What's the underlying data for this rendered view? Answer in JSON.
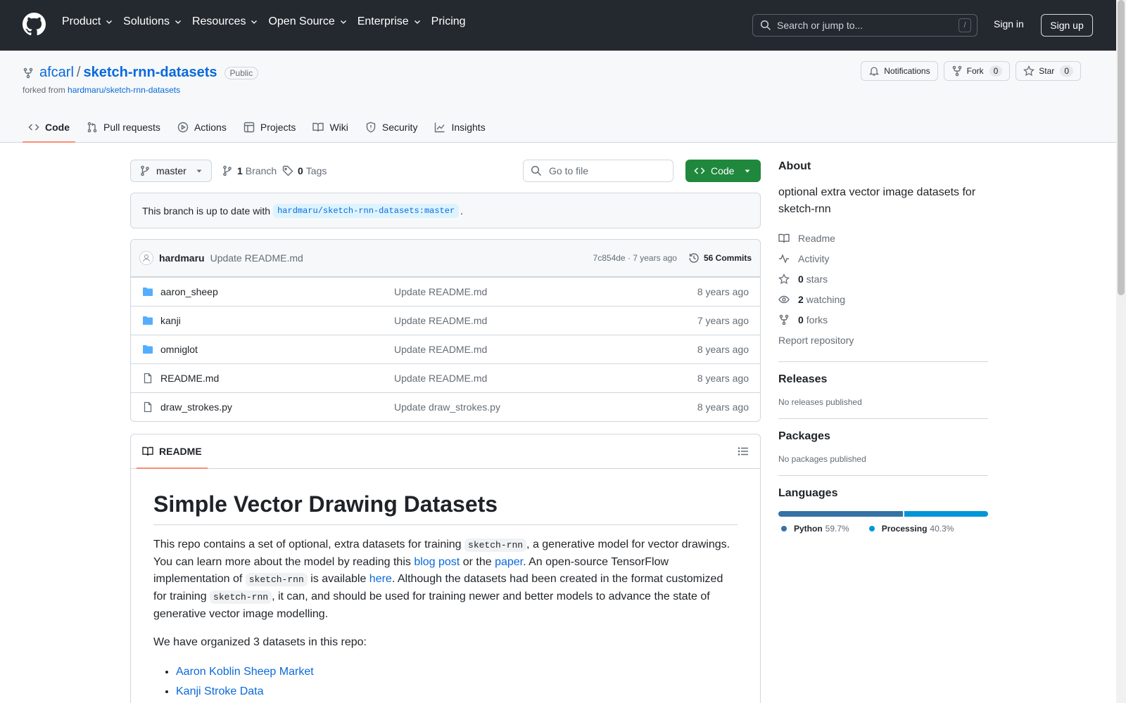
{
  "header": {
    "nav": [
      "Product",
      "Solutions",
      "Resources",
      "Open Source",
      "Enterprise"
    ],
    "pricing": "Pricing",
    "search_placeholder": "Search or jump to...",
    "search_key": "/",
    "sign_in": "Sign in",
    "sign_up": "Sign up"
  },
  "repo": {
    "owner": "afcarl",
    "separator": "/",
    "name": "sketch-rnn-datasets",
    "visibility": "Public",
    "forked_from_prefix": "forked from ",
    "forked_from": "hardmaru/sketch-rnn-datasets",
    "notifications_label": "Notifications",
    "fork_label": "Fork",
    "fork_count": "0",
    "star_label": "Star",
    "star_count": "0"
  },
  "tabs": [
    "Code",
    "Pull requests",
    "Actions",
    "Projects",
    "Wiki",
    "Security",
    "Insights"
  ],
  "toolbar": {
    "branch": "master",
    "branch_count": "1",
    "branch_label": "Branch",
    "tag_count": "0",
    "tag_label": "Tags",
    "goto_placeholder": "Go to file",
    "code_button": "Code"
  },
  "uptodate": {
    "prefix": "This branch is up to date with",
    "ref": "hardmaru/sketch-rnn-datasets:master",
    "suffix": "."
  },
  "commit": {
    "author": "hardmaru",
    "message": "Update README.md",
    "meta": "7c854de · 7 years ago",
    "count_label": "56 Commits"
  },
  "files": [
    {
      "type": "folder",
      "name": "aaron_sheep",
      "message": "Update README.md",
      "age": "8 years ago"
    },
    {
      "type": "folder",
      "name": "kanji",
      "message": "Update README.md",
      "age": "7 years ago"
    },
    {
      "type": "folder",
      "name": "omniglot",
      "message": "Update README.md",
      "age": "8 years ago"
    },
    {
      "type": "file",
      "name": "README.md",
      "message": "Update README.md",
      "age": "8 years ago"
    },
    {
      "type": "file",
      "name": "draw_strokes.py",
      "message": "Update draw_strokes.py",
      "age": "8 years ago"
    }
  ],
  "readme": {
    "tab": "README",
    "title": "Simple Vector Drawing Datasets",
    "p1": {
      "t1": "This repo contains a set of optional, extra datasets for training ",
      "c1": "sketch-rnn",
      "t2": ", a generative model for vector drawings. You can learn more about the model by reading this ",
      "l1": "blog post",
      "t3": " or the ",
      "l2": "paper",
      "t4": ". An open-source TensorFlow implementation of ",
      "c2": "sketch-rnn",
      "t5": " is available ",
      "l3": "here",
      "t6": ". Although the datasets had been created in the format customized for training ",
      "c3": "sketch-rnn",
      "t7": ", it can, and should be used for training newer and better models to advance the state of generative vector image modelling."
    },
    "p2": "We have organized 3 datasets in this repo:",
    "list": [
      "Aaron Koblin Sheep Market",
      "Kanji Stroke Data"
    ]
  },
  "about": {
    "title": "About",
    "description": "optional extra vector image datasets for sketch-rnn",
    "readme": "Readme",
    "activity": "Activity",
    "stars_count": "0",
    "stars_label": "stars",
    "watching_count": "2",
    "watching_label": "watching",
    "forks_count": "0",
    "forks_label": "forks",
    "report": "Report repository"
  },
  "releases": {
    "title": "Releases",
    "empty": "No releases published"
  },
  "packages": {
    "title": "Packages",
    "empty": "No packages published"
  },
  "languages": {
    "title": "Languages",
    "items": [
      {
        "name": "Python",
        "percent": "59.7%",
        "value": 59.7,
        "color": "#3572A5"
      },
      {
        "name": "Processing",
        "percent": "40.3%",
        "value": 40.3,
        "color": "#0096D8"
      }
    ]
  }
}
